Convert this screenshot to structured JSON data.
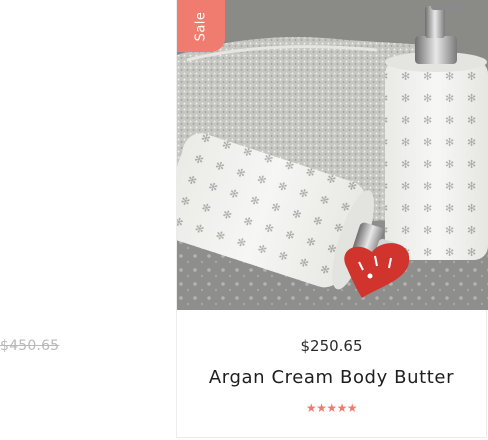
{
  "left_product": {
    "old_price": "$450.65"
  },
  "product": {
    "badge": "Sale",
    "price": "$250.65",
    "title": "Argan Cream Body Butter",
    "rating_stars": "★★★★★",
    "rating": 5,
    "image_alt": "product-photo"
  },
  "colors": {
    "accent": "#f07b6f",
    "text": "#1e1e1e",
    "muted": "#b9b9b9"
  }
}
